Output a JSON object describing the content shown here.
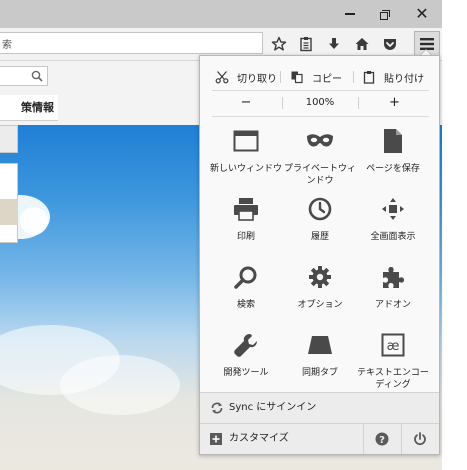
{
  "window": {
    "minimize_label": "",
    "restore_label": "",
    "close_label": "✕"
  },
  "urlbar": {
    "value": "索"
  },
  "content": {
    "security_info_label": "策情報"
  },
  "menu": {
    "edit": {
      "cut": "切り取り",
      "copy": "コピー",
      "paste": "貼り付け"
    },
    "zoom": {
      "out": "−",
      "level": "100%",
      "in": "+"
    },
    "items": [
      {
        "label": "新しいウィンドウ",
        "icon": "window-icon"
      },
      {
        "label": "プライベートウィンドウ",
        "icon": "mask-icon"
      },
      {
        "label": "ページを保存",
        "icon": "page-icon"
      },
      {
        "label": "印刷",
        "icon": "printer-icon"
      },
      {
        "label": "履歴",
        "icon": "clock-icon"
      },
      {
        "label": "全画面表示",
        "icon": "fullscreen-icon"
      },
      {
        "label": "検索",
        "icon": "search-icon"
      },
      {
        "label": "オプション",
        "icon": "gear-icon"
      },
      {
        "label": "アドオン",
        "icon": "puzzle-icon"
      },
      {
        "label": "開発ツール",
        "icon": "wrench-icon"
      },
      {
        "label": "同期タブ",
        "icon": "synced-tabs-icon"
      },
      {
        "label": "テキストエンコーディング",
        "icon": "encoding-icon"
      }
    ],
    "sync_label": "Sync にサインイン",
    "customize_label": "カスタマイズ"
  },
  "colors": {
    "titlebar": "#c9c9c9",
    "toolbar": "#f2f2f2",
    "panel": "#f9f9f9",
    "icon": "#4a4a4a"
  }
}
